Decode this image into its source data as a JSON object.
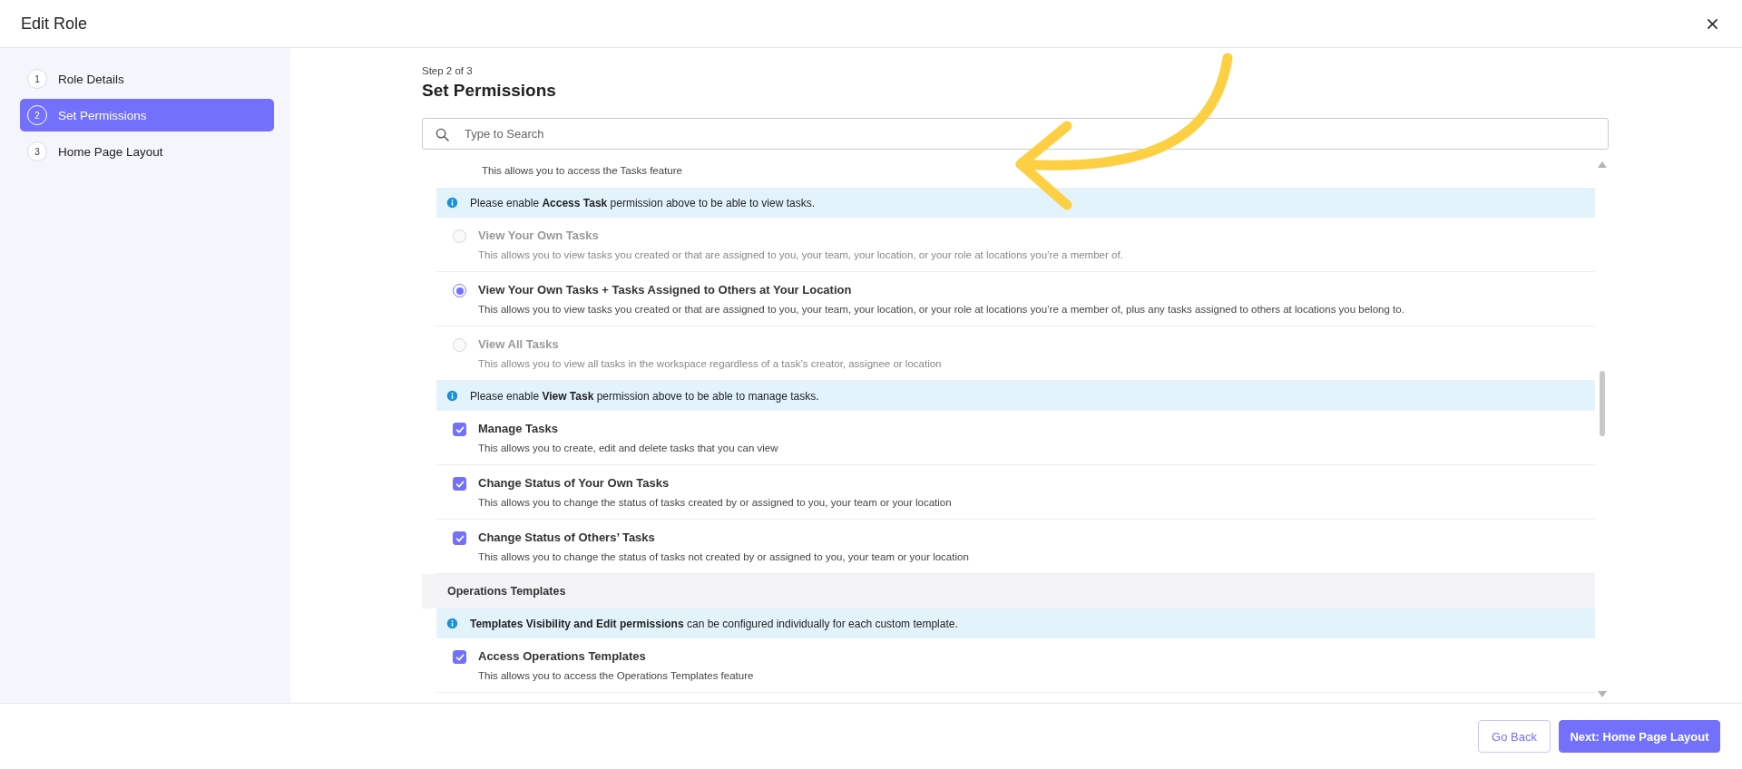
{
  "window": {
    "title": "Edit Role"
  },
  "steps": [
    {
      "number": "1",
      "label": "Role Details",
      "selected": false
    },
    {
      "number": "2",
      "label": "Set Permissions",
      "selected": true
    },
    {
      "number": "3",
      "label": "Home Page Layout",
      "selected": false
    }
  ],
  "step_label": "Step 2 of 3",
  "heading": "Set Permissions",
  "search": {
    "placeholder": "Type to Search"
  },
  "permissions": [
    {
      "kind": "description",
      "description": "This allows you to access the Tasks feature"
    },
    {
      "kind": "info",
      "text": "Please enable **Access Task** permission above to be able to view tasks."
    },
    {
      "kind": "radio",
      "title": "View Your Own Tasks",
      "description": "This allows you to view tasks you created or that are assigned to you, your team, your location, or your role at locations you’re a member of.",
      "selected": false,
      "disabled": true
    },
    {
      "kind": "radio",
      "title": "View Your Own Tasks + Tasks Assigned to Others at Your Location",
      "description": "This allows you to view tasks you created or that are assigned to you, your team, your location, or your role at locations you’re a member of, plus any tasks assigned to others at locations you belong to.",
      "selected": true,
      "disabled": false
    },
    {
      "kind": "radio",
      "title": "View All Tasks",
      "description": "This allows you to view all tasks in the workspace regardless of a task’s creator, assignee or location",
      "selected": false,
      "disabled": true
    },
    {
      "kind": "info",
      "text": "Please enable **View Task** permission above to be able to manage tasks."
    },
    {
      "kind": "checkbox",
      "title": "Manage Tasks",
      "description": "This allows you to create, edit and delete tasks that you can view",
      "checked": true
    },
    {
      "kind": "checkbox",
      "title": "Change Status of Your Own Tasks",
      "description": "This allows you to change the status of tasks created by or assigned to you, your team or your location",
      "checked": true
    },
    {
      "kind": "checkbox",
      "title": "Change Status of Others’ Tasks",
      "description": "This allows you to change the status of tasks not created by or assigned to you, your team or your location",
      "checked": true
    },
    {
      "kind": "section",
      "title": "Operations Templates"
    },
    {
      "kind": "info",
      "text": "**Templates Visibility and Edit permissions** can be configured individually for each custom template."
    },
    {
      "kind": "checkbox",
      "title": "Access Operations Templates",
      "description": "This allows you to access the Operations Templates feature",
      "checked": true
    }
  ],
  "buttons": [
    {
      "kind": "secondary",
      "label": "Go Back"
    },
    {
      "kind": "primary",
      "label": "Next: Home Page Layout"
    }
  ]
}
